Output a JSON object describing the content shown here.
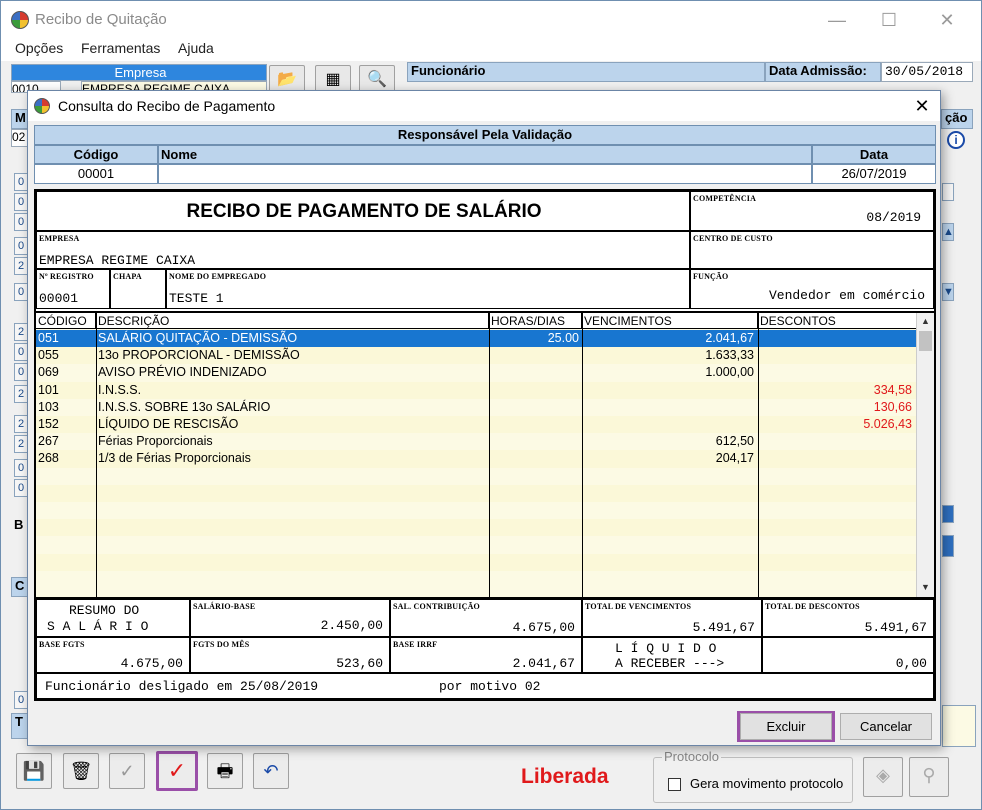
{
  "window": {
    "title": "Recibo de Quitação",
    "minimize": "—",
    "maximize": "☐",
    "close": "✕"
  },
  "menu": [
    "Opções",
    "Ferramentas",
    "Ajuda"
  ],
  "background": {
    "empresa_header": "Empresa",
    "empresa_code": "0010",
    "empresa_name": "EMPRESA REGIME CAIXA",
    "funcionario_header": "Funcionário",
    "funcionario_code": "00001",
    "funcionario_name": "TESTE 1",
    "data_admissao_label": "Data Admissão:",
    "data_admissao_value": "30/05/2018",
    "side_label_m": "M",
    "side_label_02": "02",
    "side_label_cao": "ção",
    "side_label_t": "T",
    "side_label_b": "B",
    "side_label_c": "C",
    "left_nums": [
      "0",
      "0",
      "0",
      "0",
      "2",
      "0",
      "2",
      "0",
      "0",
      "2",
      "2",
      "2",
      "0",
      "0",
      "0",
      "0"
    ],
    "status": "Liberada",
    "protocolo_title": "Protocolo",
    "protocolo_checkbox": "Gera movimento protocolo"
  },
  "dialog": {
    "title": "Consulta do Recibo de Pagamento",
    "close": "✕",
    "validation": {
      "header": "Responsável Pela Validação",
      "col_codigo": "Código",
      "col_nome": "Nome",
      "col_data": "Data",
      "codigo": "00001",
      "nome": "",
      "data": "26/07/2019"
    },
    "receipt": {
      "title": "RECIBO DE PAGAMENTO DE SALÁRIO",
      "competencia_label": "COMPETÊNCIA",
      "competencia": "08/2019",
      "empresa_label": "EMPRESA",
      "empresa": "EMPRESA REGIME CAIXA",
      "centro_custo_label": "CENTRO DE CUSTO",
      "centro_custo": "",
      "registro_label": "Nº REGISTRO",
      "registro": "00001",
      "chapa_label": "CHAPA",
      "chapa": "",
      "nome_label": "NOME DO EMPREGADO",
      "nome": "TESTE 1",
      "funcao_label": "FUNÇÃO",
      "funcao": "Vendedor em comércio",
      "columns": [
        "CÓDIGO",
        "DESCRIÇÃO",
        "HORAS/DIAS",
        "VENCIMENTOS",
        "DESCONTOS"
      ],
      "items": [
        {
          "codigo": "051",
          "descricao": "SALÁRIO QUITAÇÃO - DEMISSÃO",
          "horas": "25.00",
          "vencimentos": "2.041,67",
          "descontos": ""
        },
        {
          "codigo": "055",
          "descricao": "13o PROPORCIONAL - DEMISSÃO",
          "horas": "",
          "vencimentos": "1.633,33",
          "descontos": ""
        },
        {
          "codigo": "069",
          "descricao": "AVISO PRÉVIO INDENIZADO",
          "horas": "",
          "vencimentos": "1.000,00",
          "descontos": ""
        },
        {
          "codigo": "101",
          "descricao": "I.N.S.S.",
          "horas": "",
          "vencimentos": "",
          "descontos": "334,58"
        },
        {
          "codigo": "103",
          "descricao": "I.N.S.S. SOBRE 13o SALÁRIO",
          "horas": "",
          "vencimentos": "",
          "descontos": "130,66"
        },
        {
          "codigo": "152",
          "descricao": "LÍQUIDO DE RESCISÃO",
          "horas": "",
          "vencimentos": "",
          "descontos": "5.026,43"
        },
        {
          "codigo": "267",
          "descricao": "Férias Proporcionais",
          "horas": "",
          "vencimentos": "612,50",
          "descontos": ""
        },
        {
          "codigo": "268",
          "descricao": "1/3 de Férias Proporcionais",
          "horas": "",
          "vencimentos": "204,17",
          "descontos": ""
        }
      ],
      "resumo_line1": "RESUMO DO",
      "resumo_line2": "S A L Á R I O",
      "salario_base_label": "SALÁRIO-BASE",
      "salario_base": "2.450,00",
      "sal_contribuicao_label": "SAL. CONTRIBUIÇÃO",
      "sal_contribuicao": "4.675,00",
      "total_vencimentos_label": "TOTAL DE VENCIMENTOS",
      "total_vencimentos": "5.491,67",
      "total_descontos_label": "TOTAL DE DESCONTOS",
      "total_descontos": "5.491,67",
      "base_fgts_label": "BASE FGTS",
      "base_fgts": "4.675,00",
      "fgts_mes_label": "FGTS DO MÊS",
      "fgts_mes": "523,60",
      "base_irrf_label": "BASE IRRF",
      "base_irrf": "2.041,67",
      "liquido_line1": "L Í Q U I D O",
      "liquido_line2": "A RECEBER --->",
      "liquido": "0,00",
      "footer_note": "Funcionário desligado em 25/08/2019",
      "footer_motivo": "por motivo 02"
    },
    "btn_excluir": "Excluir",
    "btn_cancelar": "Cancelar"
  },
  "colors": {
    "selected_row": "#1876d0",
    "discount_red": "#e0191b",
    "header_blue": "#bcd4ec",
    "highlight_border": "#9a4fa8"
  }
}
